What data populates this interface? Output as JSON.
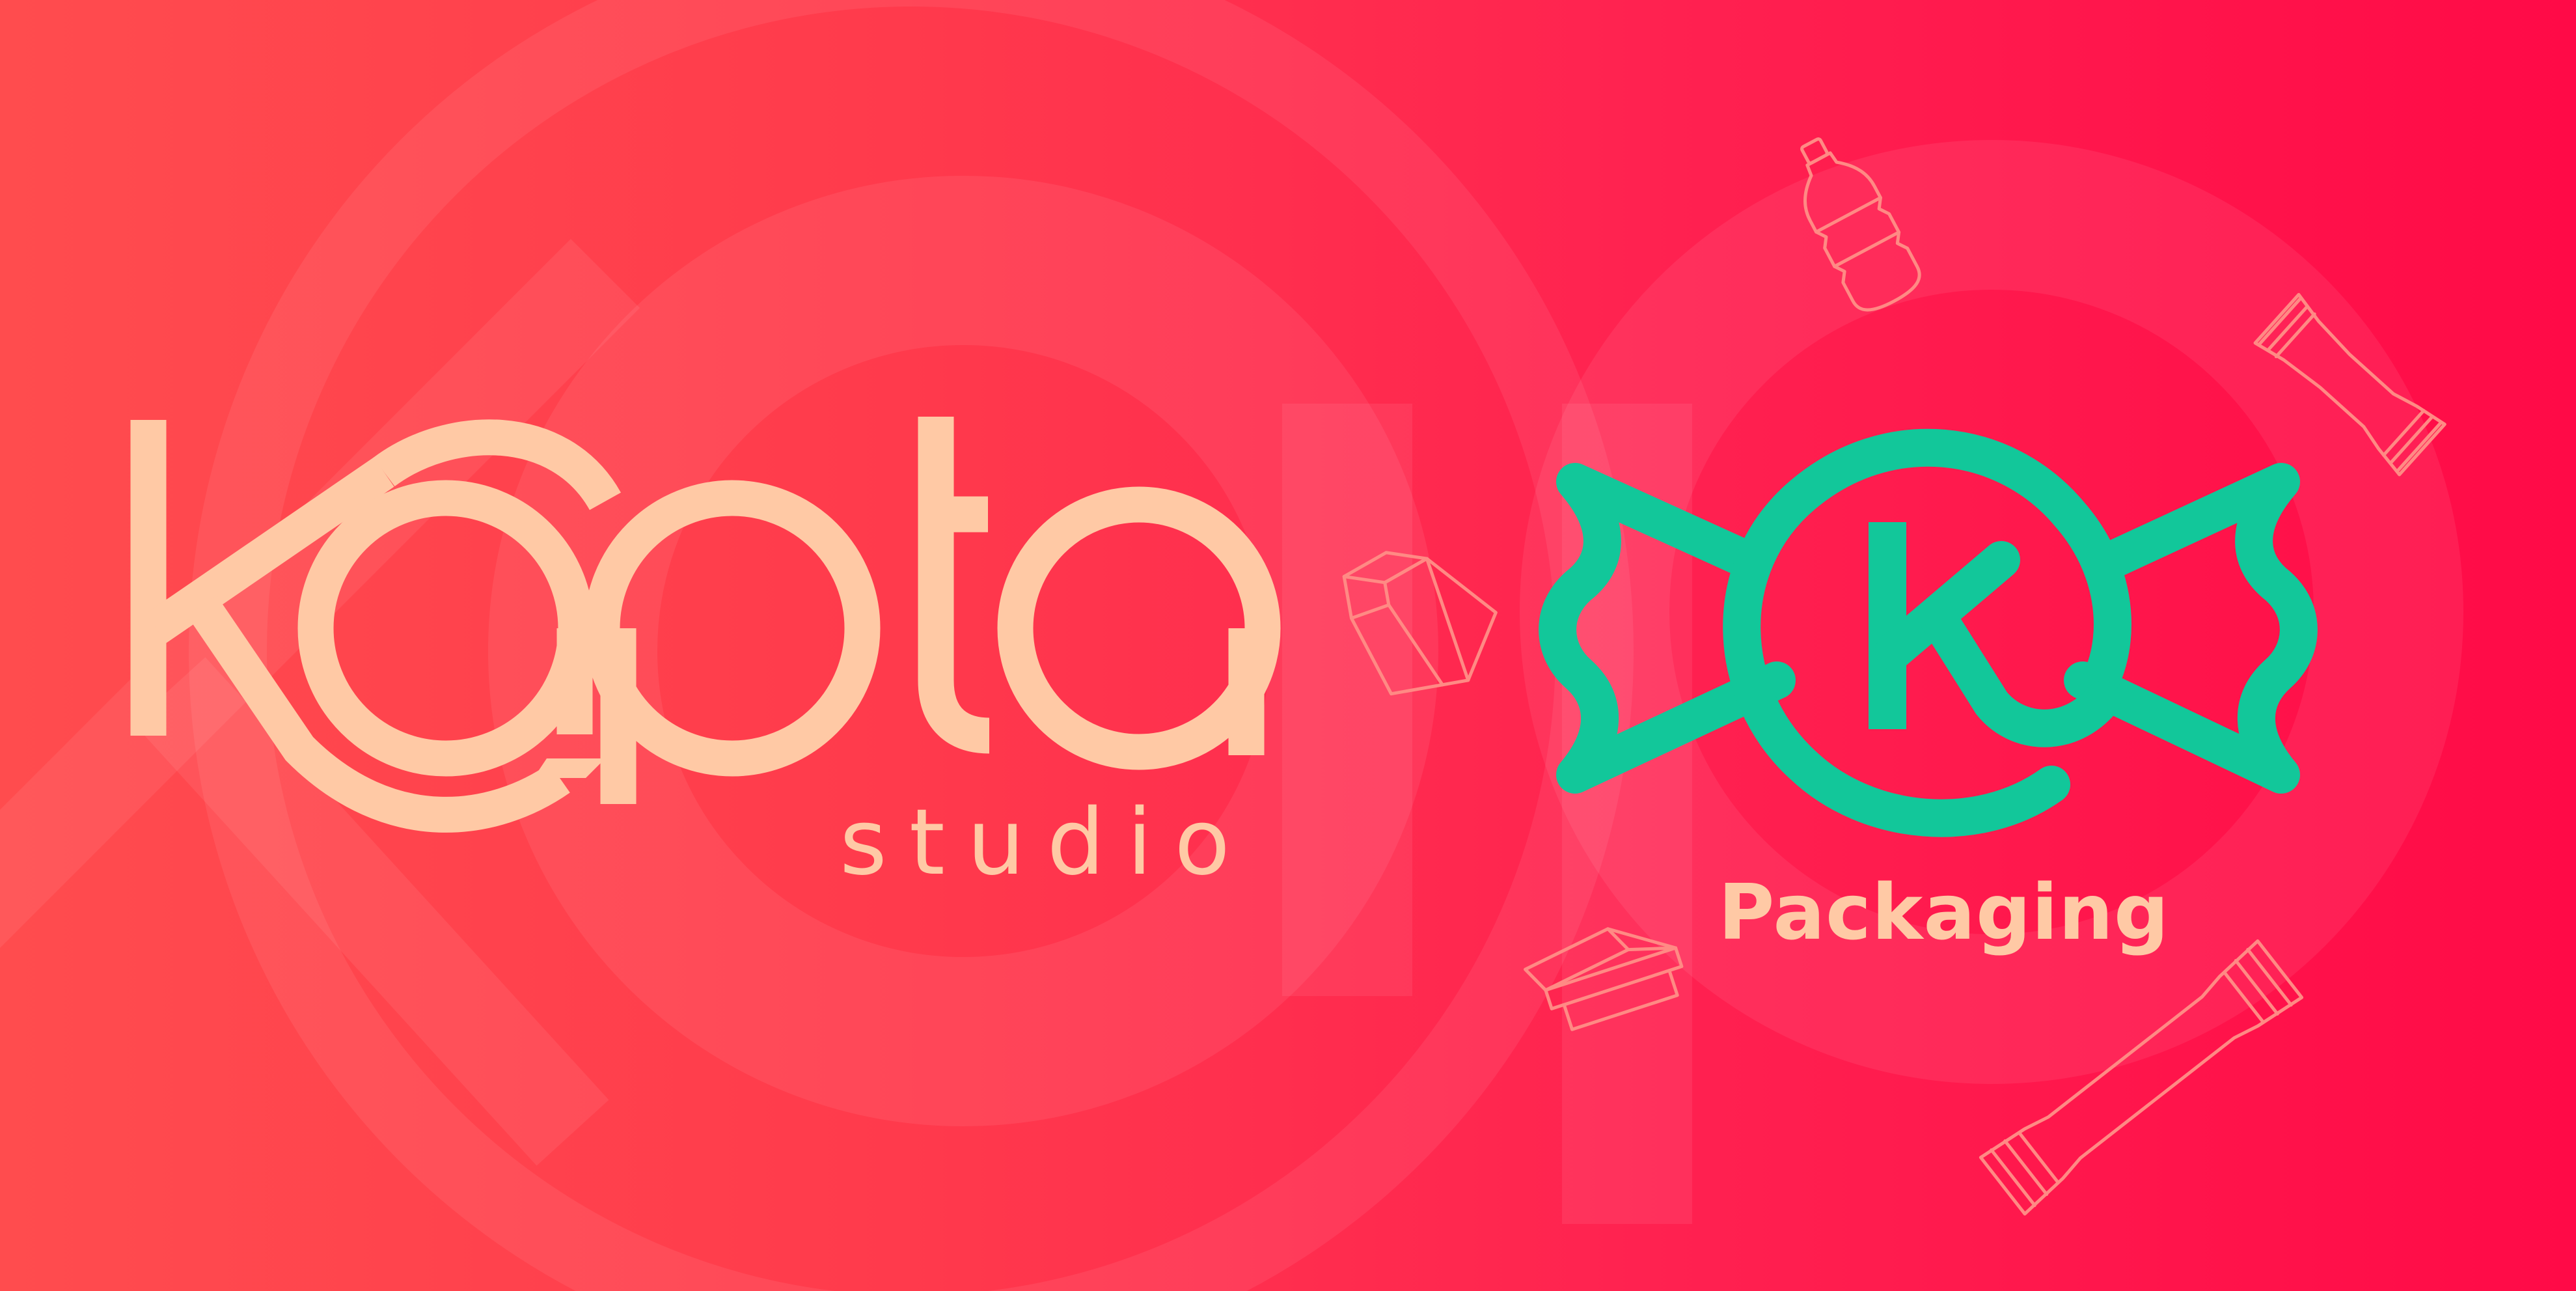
{
  "brand": {
    "name": "kapta",
    "tagline": "studio"
  },
  "product_logo": {
    "letter": "k",
    "label": "Packaging"
  },
  "icons": [
    "bottle-icon",
    "snack-bar-icon",
    "milk-carton-icon",
    "takeout-box-icon",
    "wrapper-bar-icon"
  ],
  "colors": {
    "background_left": "#ff4c4e",
    "background_right": "#ff0a47",
    "brand_peach": "#ffc9a5",
    "candy_green": "#12c79a",
    "icon_outline": "#ff8a84"
  }
}
